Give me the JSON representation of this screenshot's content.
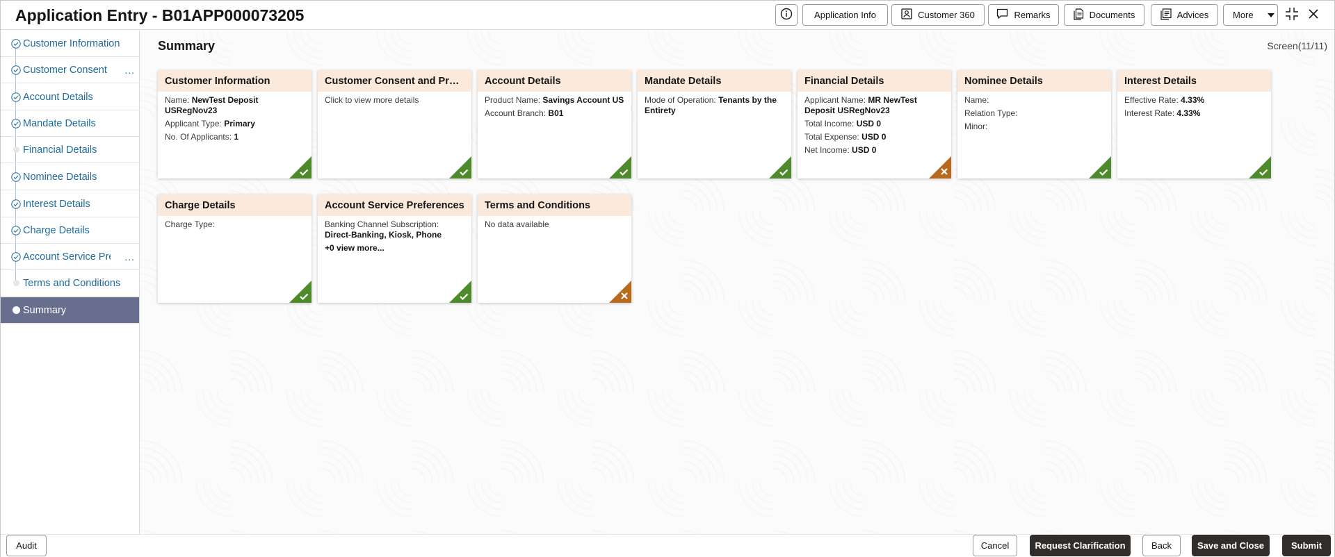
{
  "header": {
    "title": "Application Entry - B01APP000073205",
    "buttons": {
      "application_info": "Application Info",
      "customer_360": "Customer 360",
      "remarks": "Remarks",
      "documents": "Documents",
      "advices": "Advices",
      "more": "More"
    },
    "icons": [
      "info-icon",
      "person-card-icon",
      "chat-icon",
      "document-icon",
      "advices-icon",
      "chevron-down-icon",
      "collapse-icon",
      "close-icon"
    ]
  },
  "sidebar": {
    "items": [
      {
        "label": "Customer Information",
        "status": "done"
      },
      {
        "label": "Customer Consent and Preferences",
        "status": "done"
      },
      {
        "label": "Account Details",
        "status": "done"
      },
      {
        "label": "Mandate Details",
        "status": "done"
      },
      {
        "label": "Financial Details",
        "status": "pending"
      },
      {
        "label": "Nominee Details",
        "status": "done"
      },
      {
        "label": "Interest Details",
        "status": "done"
      },
      {
        "label": "Charge Details",
        "status": "done"
      },
      {
        "label": "Account Service Preferences",
        "status": "done"
      },
      {
        "label": "Terms and Conditions",
        "status": "pending"
      },
      {
        "label": "Summary",
        "status": "active"
      }
    ],
    "truncation": "..."
  },
  "main": {
    "title": "Summary",
    "screen_indicator": "Screen(11/11)"
  },
  "cards": {
    "customer_information": {
      "title": "Customer Information",
      "name_label": "Name:",
      "name_value": "NewTest Deposit USRegNov23",
      "type_label": "Applicant Type:",
      "type_value": "Primary",
      "count_label": "No. Of Applicants:",
      "count_value": "1",
      "status": "complete"
    },
    "customer_consent": {
      "title": "Customer Consent and Preferences",
      "text": "Click to view more details",
      "status": "complete"
    },
    "account_details": {
      "title": "Account Details",
      "product_label": "Product Name:",
      "product_value": "Savings Account US",
      "branch_label": "Account Branch:",
      "branch_value": "B01",
      "status": "complete"
    },
    "mandate_details": {
      "title": "Mandate Details",
      "mode_label": "Mode of Operation:",
      "mode_value": "Tenants by the Entirety",
      "status": "complete"
    },
    "financial_details": {
      "title": "Financial Details",
      "applicant_label": "Applicant Name:",
      "applicant_value": "MR NewTest Deposit USRegNov23",
      "income_label": "Total Income:",
      "income_value": "USD 0",
      "expense_label": "Total Expense:",
      "expense_value": "USD 0",
      "net_label": "Net Income:",
      "net_value": "USD 0",
      "status": "incomplete"
    },
    "nominee_details": {
      "title": "Nominee Details",
      "name_label": "Name:",
      "relation_label": "Relation Type:",
      "minor_label": "Minor:",
      "status": "complete"
    },
    "interest_details": {
      "title": "Interest Details",
      "effective_label": "Effective Rate:",
      "effective_value": "4.33%",
      "interest_label": "Interest Rate:",
      "interest_value": "4.33%",
      "status": "complete"
    },
    "charge_details": {
      "title": "Charge Details",
      "type_label": "Charge Type:",
      "status": "complete"
    },
    "account_service_preferences": {
      "title": "Account Service Preferences",
      "channel_label": "Banking Channel Subscription:",
      "channel_value": "Direct-Banking, Kiosk, Phone",
      "more": "+0 view more...",
      "status": "complete"
    },
    "terms_and_conditions": {
      "title": "Terms and Conditions",
      "text": "No data available",
      "status": "incomplete"
    }
  },
  "footer": {
    "audit": "Audit",
    "cancel": "Cancel",
    "request_clarification": "Request Clarification",
    "back": "Back",
    "save_and_close": "Save and Close",
    "submit": "Submit"
  },
  "colors": {
    "complete": "#4e8a2b",
    "incomplete": "#b86a1c",
    "card_header": "#fbeadb",
    "sidebar_active": "#676e8e",
    "link": "#1e6b9c",
    "primary_button": "#312d2a"
  }
}
